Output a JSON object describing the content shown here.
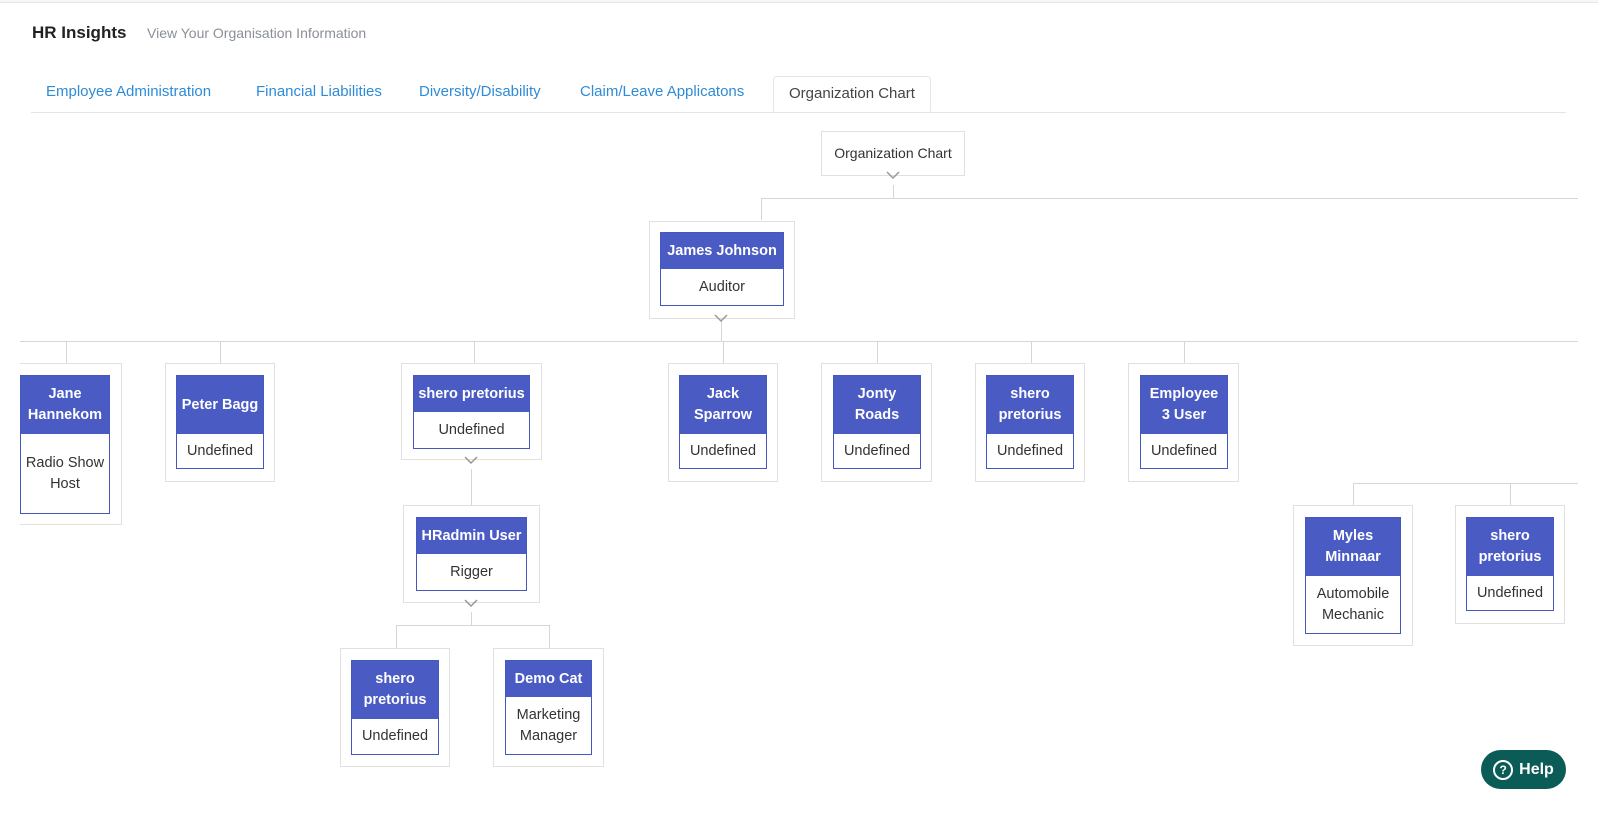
{
  "header": {
    "title": "HR Insights",
    "subtitle": "View Your Organisation Information"
  },
  "tabs": [
    {
      "label": "Employee Administration",
      "active": false
    },
    {
      "label": "Financial Liabilities",
      "active": false
    },
    {
      "label": "Diversity/Disability",
      "active": false
    },
    {
      "label": "Claim/Leave Applicatons",
      "active": false
    },
    {
      "label": "Organization Chart",
      "active": true
    }
  ],
  "org_chart": {
    "root": {
      "label": "Organization Chart"
    },
    "nodes": [
      {
        "name": "James Johnson",
        "role": "Auditor"
      },
      {
        "name": "Jane Hannekom",
        "role": "Radio Show Host"
      },
      {
        "name": "Peter Bagg",
        "role": "Undefined"
      },
      {
        "name": "shero pretorius",
        "role": "Undefined"
      },
      {
        "name": "HRadmin User",
        "role": "Rigger"
      },
      {
        "name": "shero pretorius",
        "role": "Undefined"
      },
      {
        "name": "Demo Cat",
        "role": "Marketing Manager"
      },
      {
        "name": "Jack Sparrow",
        "role": "Undefined"
      },
      {
        "name": "Jonty Roads",
        "role": "Undefined"
      },
      {
        "name": "shero pretorius",
        "role": "Undefined"
      },
      {
        "name": "Employee 3 User",
        "role": "Undefined"
      },
      {
        "name": "Myles Minnaar",
        "role": "Automobile Mechanic"
      },
      {
        "name": "shero pretorius",
        "role": "Undefined"
      }
    ]
  },
  "help": {
    "label": "Help",
    "icon": "question-circle-icon"
  },
  "colors": {
    "card_header": "#4a5bc4",
    "card_border": "#4558c0",
    "tab_link": "#2e8bd6",
    "help_button": "#0b5c57"
  }
}
